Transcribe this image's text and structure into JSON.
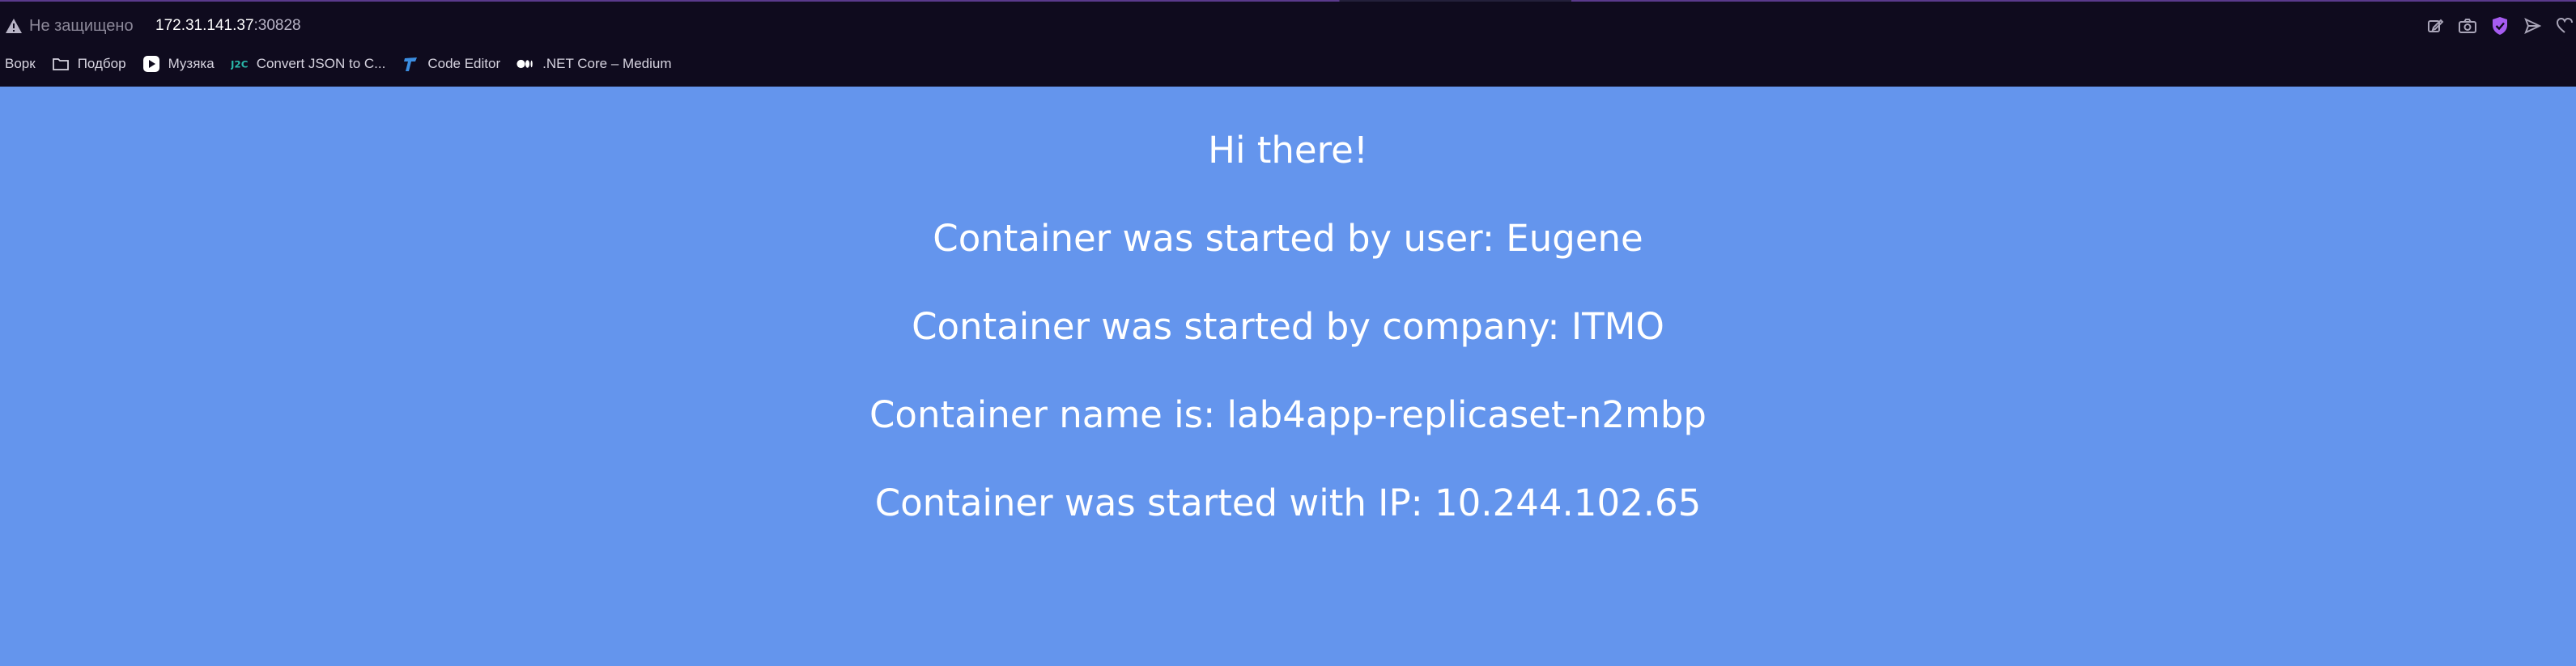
{
  "browser": {
    "security_label": "Не защищено",
    "url_host": "172.31.141.37",
    "url_port": ":30828",
    "bookmarks": [
      {
        "label": "Ворк",
        "icon": "none"
      },
      {
        "label": "Подбор",
        "icon": "folder-icon"
      },
      {
        "label": "Музяка",
        "icon": "play-icon"
      },
      {
        "label": "Convert JSON to C...",
        "icon": "j2c-icon"
      },
      {
        "label": "Code Editor",
        "icon": "code-editor-icon"
      },
      {
        "label": ".NET Core – Medium",
        "icon": "medium-icon"
      }
    ],
    "toolbar_icons": [
      "edit-icon",
      "camera-icon",
      "shield-icon",
      "send-icon",
      "heart-icon"
    ]
  },
  "page": {
    "background": "#6495ed",
    "greeting": "Hi there!",
    "user_line": "Container was started by user: Eugene",
    "company_line": "Container was started by company: ITMO",
    "name_line": "Container name is: lab4app-replicaset-n2mbp",
    "ip_line": "Container was started with IP: 10.244.102.65"
  }
}
